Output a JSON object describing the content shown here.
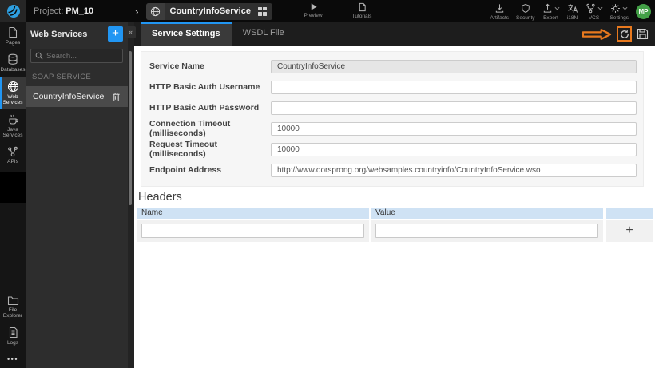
{
  "topbar": {
    "project_label": "Project:",
    "project_name": "PM_10",
    "breadcrumb_separator": "›",
    "service_name": "CountryInfoService",
    "preview_label": "Preview",
    "tutorials_label": "Tutorials",
    "actions": [
      {
        "label": "Artifacts",
        "icon": "download-icon",
        "has_dropdown": false
      },
      {
        "label": "Security",
        "icon": "shield-icon",
        "has_dropdown": false
      },
      {
        "label": "Export",
        "icon": "upload-icon",
        "has_dropdown": true
      },
      {
        "label": "i18N",
        "icon": "translate-icon",
        "has_dropdown": false
      },
      {
        "label": "VCS",
        "icon": "branch-icon",
        "has_dropdown": true
      },
      {
        "label": "Settings",
        "icon": "gear-icon",
        "has_dropdown": true
      }
    ],
    "avatar_initials": "MP"
  },
  "rail": {
    "items": [
      {
        "label": "Pages",
        "active": false
      },
      {
        "label": "Databases",
        "active": false
      },
      {
        "label": "Web Services",
        "active": true
      },
      {
        "label": "Java Services",
        "active": false
      },
      {
        "label": "APIs",
        "active": false
      }
    ],
    "bottom_items": [
      {
        "label": "File Explorer"
      },
      {
        "label": "Logs"
      }
    ],
    "more_icon": "•••"
  },
  "panel": {
    "title": "Web Services",
    "add_button": "+",
    "collapse_button": "«",
    "search_placeholder": "Search...",
    "section_title": "SOAP SERVICE",
    "items": [
      {
        "label": "CountryInfoService",
        "selected": true
      }
    ]
  },
  "tabs": [
    {
      "label": "Service Settings",
      "active": true
    },
    {
      "label": "WSDL File",
      "active": false
    }
  ],
  "form": {
    "rows": [
      {
        "label": "Service Name",
        "value": "CountryInfoService",
        "disabled": true
      },
      {
        "label": "HTTP Basic Auth Username",
        "value": ""
      },
      {
        "label": "HTTP Basic Auth Password",
        "value": ""
      },
      {
        "label": "Connection Timeout (milliseconds)",
        "value": "10000"
      },
      {
        "label": "Request Timeout (milliseconds)",
        "value": "10000"
      },
      {
        "label": "Endpoint Address",
        "value": "http://www.oorsprong.org/websamples.countryinfo/CountryInfoService.wso"
      }
    ]
  },
  "headers_table": {
    "title": "Headers",
    "columns": [
      "Name",
      "Value"
    ],
    "add_row_button": "+",
    "rows": [
      {
        "name": "",
        "value": ""
      }
    ]
  },
  "colors": {
    "accent_blue": "#2196f3",
    "annotation_orange": "#e8791e",
    "table_header_blue": "#cfe2f4",
    "avatar_green": "#43a047"
  }
}
